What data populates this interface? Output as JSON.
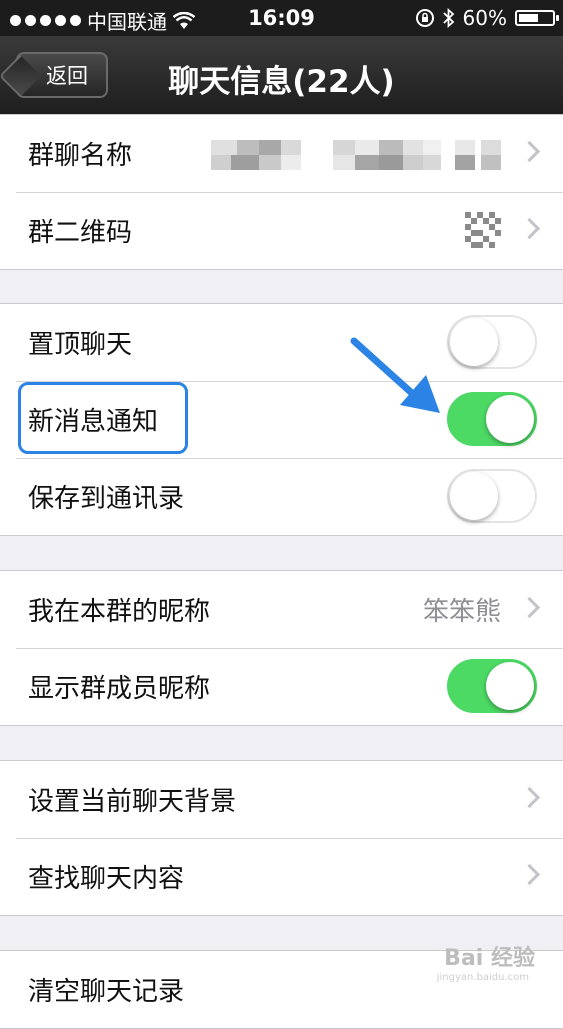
{
  "status_bar": {
    "carrier": "中国联通",
    "time": "16:09",
    "battery": "60%",
    "battery_level": 0.6
  },
  "nav": {
    "back_label": "返回",
    "title": "聊天信息(22人)"
  },
  "groups": [
    {
      "rows": [
        {
          "label": "群聊名称",
          "type": "pixelated-value"
        },
        {
          "label": "群二维码",
          "type": "qr"
        }
      ]
    },
    {
      "rows": [
        {
          "label": "置顶聊天",
          "toggle": false
        },
        {
          "label": "新消息通知",
          "toggle": true,
          "highlighted": true
        },
        {
          "label": "保存到通讯录",
          "toggle": false
        }
      ]
    },
    {
      "rows": [
        {
          "label": "我在本群的昵称",
          "value": "笨笨熊"
        },
        {
          "label": "显示群成员昵称",
          "toggle": true
        }
      ]
    },
    {
      "rows": [
        {
          "label": "设置当前聊天背景"
        },
        {
          "label": "查找聊天内容"
        }
      ]
    },
    {
      "rows": [
        {
          "label": "清空聊天记录"
        }
      ]
    }
  ],
  "watermark": {
    "text": "Bai 经验",
    "sub": "jingyan.baidu.com"
  },
  "colors": {
    "toggle_on": "#4cd964",
    "highlight": "#2b83e6",
    "nav_bg": "#1e1e1e"
  }
}
